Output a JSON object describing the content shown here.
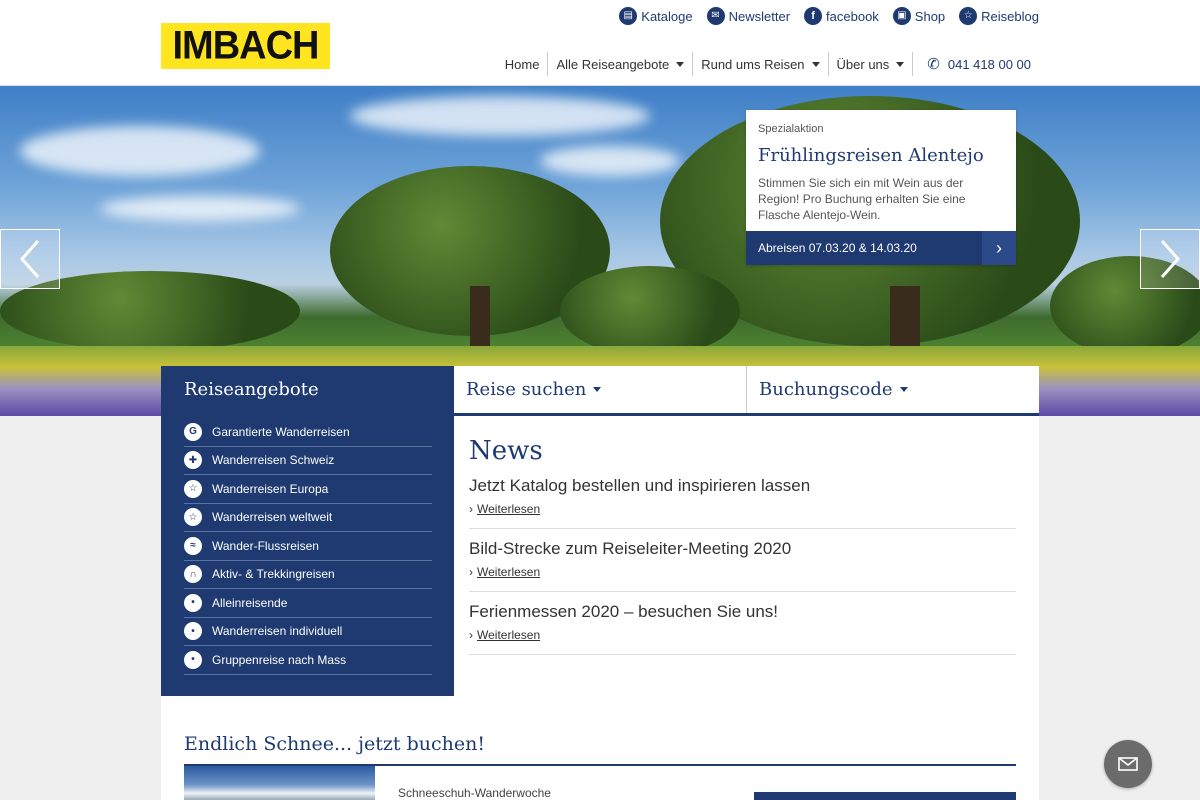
{
  "logo": {
    "text": "IMBACH"
  },
  "topbar": [
    {
      "label": "Kataloge",
      "icon": "book-icon"
    },
    {
      "label": "Newsletter",
      "icon": "mail-icon"
    },
    {
      "label": "facebook",
      "icon": "facebook-icon"
    },
    {
      "label": "Shop",
      "icon": "bag-icon"
    },
    {
      "label": "Reiseblog",
      "icon": "hiker-icon"
    }
  ],
  "mainnav": {
    "items": [
      {
        "label": "Home"
      },
      {
        "label": "Alle Reiseangebote"
      },
      {
        "label": "Rund ums Reisen"
      },
      {
        "label": "Über uns"
      }
    ],
    "phone": "041 418 00 00"
  },
  "promo": {
    "kicker": "Spezialaktion",
    "title": "Frühlingsreisen Alentejo",
    "text": "Stimmen Sie sich ein mit Wein aus der Region! Pro Buchung erhalten Sie eine Flasche Alentejo-Wein.",
    "dates": "Abreisen 07.03.20 & 14.03.20"
  },
  "sidebar": {
    "title": "Reiseangebote",
    "items": [
      {
        "label": "Garantierte Wanderreisen",
        "glyph": "G"
      },
      {
        "label": "Wanderreisen Schweiz",
        "glyph": "✚"
      },
      {
        "label": "Wanderreisen Europa",
        "glyph": "☆"
      },
      {
        "label": "Wanderreisen weltweit",
        "glyph": "☆"
      },
      {
        "label": "Wander-Flussreisen",
        "glyph": "≈"
      },
      {
        "label": "Aktiv- & Trekkingreisen",
        "glyph": "∩"
      },
      {
        "label": "Alleinreisende",
        "glyph": "•"
      },
      {
        "label": "Wanderreisen individuell",
        "glyph": "•"
      },
      {
        "label": "Gruppenreise nach Mass",
        "glyph": "•"
      }
    ]
  },
  "tabs": [
    {
      "label": "Reise suchen"
    },
    {
      "label": "Buchungscode"
    }
  ],
  "news": {
    "title": "News",
    "more_label": "Weiterlesen",
    "items": [
      {
        "headline": "Jetzt Katalog bestellen und inspirieren lassen"
      },
      {
        "headline": "Bild-Strecke zum Reiseleiter-Meeting 2020"
      },
      {
        "headline": "Ferienmessen 2020 – besuchen Sie uns!"
      }
    ]
  },
  "bottom": {
    "title": "Endlich Schnee... jetzt buchen!",
    "kicker": "Schneeschuh-Wanderwoche"
  }
}
